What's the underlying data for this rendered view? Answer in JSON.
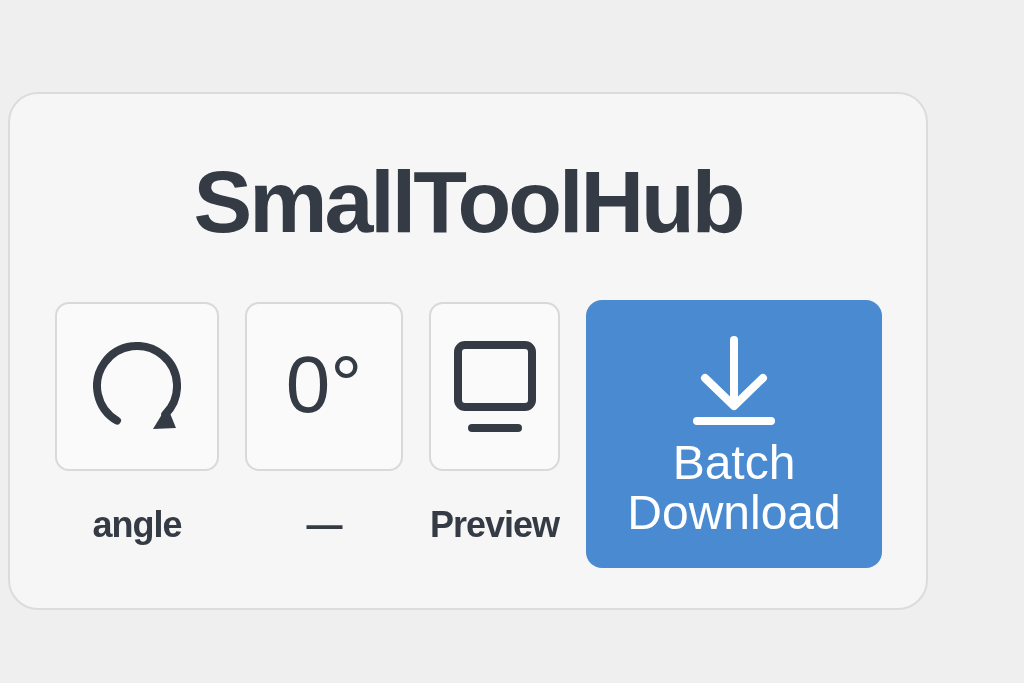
{
  "app": {
    "title": "SmallToolHub"
  },
  "tools": [
    {
      "kind": "rotate",
      "label": "angle"
    },
    {
      "kind": "value",
      "value": "0°",
      "label": "—"
    },
    {
      "kind": "preview",
      "label": "Preview"
    }
  ],
  "download_button": {
    "label": "Batch Download"
  }
}
